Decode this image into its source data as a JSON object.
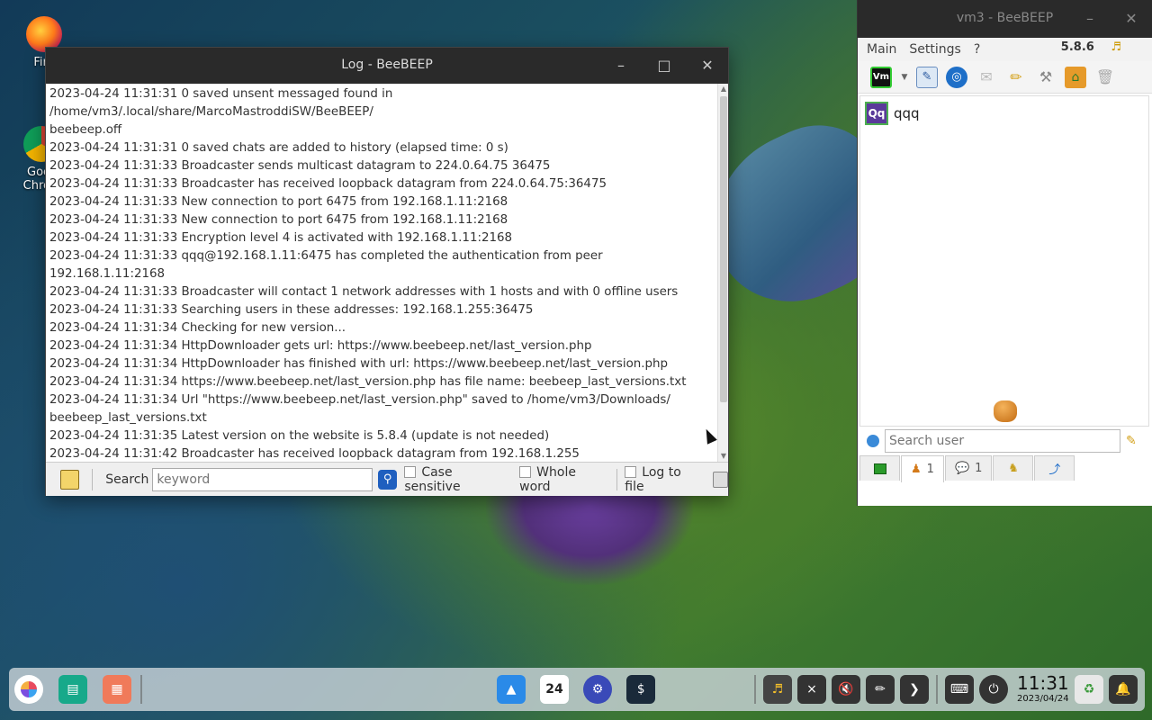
{
  "desktop": {
    "icons": [
      {
        "label": "Fire"
      },
      {
        "label": "Goo"
      },
      {
        "label": "Chro"
      }
    ]
  },
  "log_window": {
    "title": "Log - BeeBEEP",
    "lines": [
      "2023-04-24 11:31:31 0 saved unsent messaged found in /home/vm3/.local/share/MarcoMastroddiSW/BeeBEEP/\nbeebeep.off",
      "2023-04-24 11:31:31 0 saved chats are added to history (elapsed time: 0 s)",
      "2023-04-24 11:31:33 Broadcaster sends multicast datagram to 224.0.64.75 36475",
      "2023-04-24 11:31:33 Broadcaster has received loopback datagram from 224.0.64.75:36475",
      "2023-04-24 11:31:33 New connection to port 6475 from 192.168.1.11:2168",
      "2023-04-24 11:31:33 New connection to port 6475 from 192.168.1.11:2168",
      "2023-04-24 11:31:33 Encryption level 4 is activated with 192.168.1.11:2168",
      "2023-04-24 11:31:33 qqq@192.168.1.11:6475 has completed the authentication from peer 192.168.1.11:2168",
      "2023-04-24 11:31:33 Broadcaster will contact 1 network addresses with 1 hosts and with 0 offline users",
      "2023-04-24 11:31:33 Searching users in these addresses: 192.168.1.255:36475",
      "2023-04-24 11:31:34 Checking for new version...",
      "2023-04-24 11:31:34 HttpDownloader gets url: https://www.beebeep.net/last_version.php",
      "2023-04-24 11:31:34 HttpDownloader has finished with url: https://www.beebeep.net/last_version.php",
      "2023-04-24 11:31:34 https://www.beebeep.net/last_version.php has file name: beebeep_last_versions.txt",
      "2023-04-24 11:31:34 Url \"https://www.beebeep.net/last_version.php\" saved to /home/vm3/Downloads/\nbeebeep_last_versions.txt",
      "2023-04-24 11:31:35 Latest version on the website is 5.8.4 (update is not needed)",
      "2023-04-24 11:31:42 Broadcaster has received loopback datagram from 192.168.1.255"
    ],
    "toolbar": {
      "search_label": "Search",
      "search_placeholder": "keyword",
      "case_sensitive": "Case sensitive",
      "whole_word": "Whole word",
      "log_to_file": "Log to file"
    }
  },
  "bee_window": {
    "title": "vm3 - BeeBEEP",
    "menu": [
      "Main",
      "Settings",
      "?"
    ],
    "version": "5.8.6",
    "users": [
      {
        "avatar": "Qq",
        "name": "qqq"
      }
    ],
    "search_placeholder": "Search user",
    "tabs": [
      {
        "count": ""
      },
      {
        "count": "1"
      },
      {
        "count": "1"
      },
      {
        "count": ""
      },
      {
        "count": ""
      }
    ]
  },
  "taskbar": {
    "calendar_day": "24",
    "terminal_label": "$",
    "clock_time": "11:31",
    "clock_date": "2023/04/24"
  }
}
